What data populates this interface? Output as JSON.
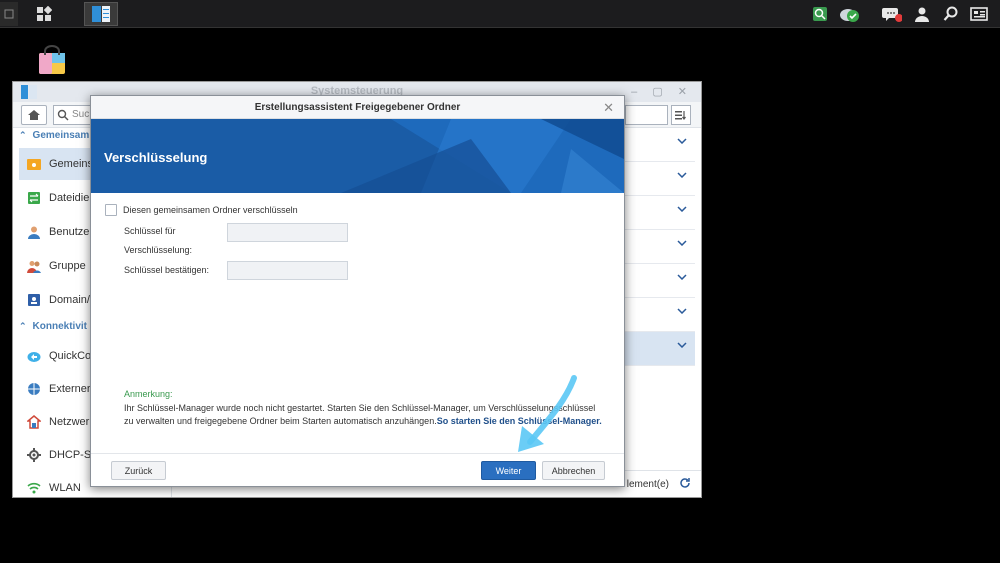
{
  "background_window": {
    "title": "Systemsteuerung",
    "search_placeholder": "Suc",
    "sidebar": {
      "sections": [
        {
          "label": "Gemeinsam"
        },
        {
          "label": "Konnektivit"
        }
      ],
      "items": [
        {
          "label": "Gemeinsa",
          "icon": "shared-folder-icon"
        },
        {
          "label": "Dateidien",
          "icon": "file-services-icon"
        },
        {
          "label": "Benutzer",
          "icon": "user-icon"
        },
        {
          "label": "Gruppe",
          "icon": "group-icon"
        },
        {
          "label": "Domain/L",
          "icon": "domain-icon"
        },
        {
          "label": "QuickCon",
          "icon": "quickconnect-icon"
        },
        {
          "label": "Externer Z",
          "icon": "external-access-icon"
        },
        {
          "label": "Netzwerk",
          "icon": "network-icon"
        },
        {
          "label": "DHCP-Ser",
          "icon": "dhcp-icon"
        },
        {
          "label": "WLAN",
          "icon": "wifi-icon"
        }
      ]
    },
    "footer_text": "lement(e)"
  },
  "wizard": {
    "title": "Erstellungsassistent Freigegebener Ordner",
    "heading": "Verschlüsselung",
    "encrypt_checkbox_label": "Diesen gemeinsamen Ordner verschlüsseln",
    "encrypt_checked": false,
    "key_label_line1": "Schlüssel für",
    "key_label_line2": "Verschlüsselung:",
    "key_value": "",
    "confirm_label": "Schlüssel bestätigen:",
    "confirm_value": "",
    "note_title": "Anmerkung:",
    "note_text": "Ihr Schlüssel-Manager wurde noch nicht gestartet. Starten Sie den Schlüssel-Manager, um Verschlüsselungsschlüssel zu verwalten und freigegebene Ordner beim Starten automatisch anzuhängen.",
    "note_link": "So starten Sie den Schlüssel-Manager.",
    "back_label": "Zurück",
    "next_label": "Weiter",
    "cancel_label": "Abbrechen"
  },
  "colors": {
    "accent": "#2a6fc0",
    "banner": "#1a5ca6",
    "note_green": "#3a9a4f",
    "annotation_arrow": "#5bc8f5"
  }
}
